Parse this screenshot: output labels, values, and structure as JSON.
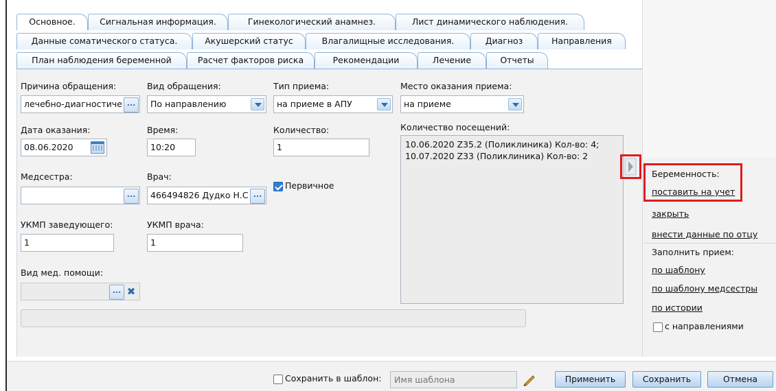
{
  "tabs": {
    "row1": [
      "Основное.",
      "Сигнальная информация.",
      "Гинекологический анамнез.",
      "Лист динамического наблюдения."
    ],
    "row2": [
      "Данные соматического статуса.",
      "Акушерский статус",
      "Влагалищные исследования.",
      "Диагноз",
      "Направления"
    ],
    "row3": [
      "План наблюдения беременной",
      "Расчет факторов риска",
      "Рекомендации",
      "Лечение",
      "Отчеты"
    ]
  },
  "form": {
    "reason_label": "Причина обращения:",
    "reason_value": "лечебно-диагностиче",
    "kind_label": "Вид обращения:",
    "kind_value": "По направлению",
    "type_label": "Тип приема:",
    "type_value": "на приеме в АПУ",
    "place_label": "Место оказания приема:",
    "place_value": "на приеме",
    "date_label": "Дата оказания:",
    "date_value": "08.06.2020",
    "time_label": "Время:",
    "time_value": "10:20",
    "count_label": "Количество:",
    "count_value": "1",
    "visits_label": "Количество посещений:",
    "visits": [
      "10.06.2020 Z35.2 (Поликлиника) Кол-во: 4;",
      "10.07.2020 Z33 (Поликлиника) Кол-во: 2"
    ],
    "nurse_label": "Медсестра:",
    "nurse_value": "",
    "doctor_label": "Врач:",
    "doctor_value": "466494826 Дудко Н.С",
    "primary_label": "Первичное",
    "primary_checked": true,
    "ukmp_head_label": "УКМП заведующего:",
    "ukmp_head_value": "1",
    "ukmp_doc_label": "УКМП врача:",
    "ukmp_doc_value": "1",
    "med_help_label": "Вид мед. помощи:",
    "med_help_value": ""
  },
  "side": {
    "pregnancy_label": "Беременность:",
    "register": "поставить на учет",
    "close": "закрыть",
    "father": "внести данные по отцу",
    "fill_label": "Заполнить прием:",
    "by_template": "по шаблону",
    "by_nurse_template": "по шаблону медсестры",
    "by_history": "по истории",
    "with_referrals": "с направлениями"
  },
  "footer": {
    "save_template_label": "Сохранить в шаблон:",
    "template_placeholder": "Имя шаблона",
    "apply": "Применить",
    "save": "Сохранить",
    "cancel": "Отмена"
  },
  "colors": {
    "highlight": "#e01b1b",
    "accent": "#2f7fd3",
    "tab_border": "#8fb4d8"
  }
}
